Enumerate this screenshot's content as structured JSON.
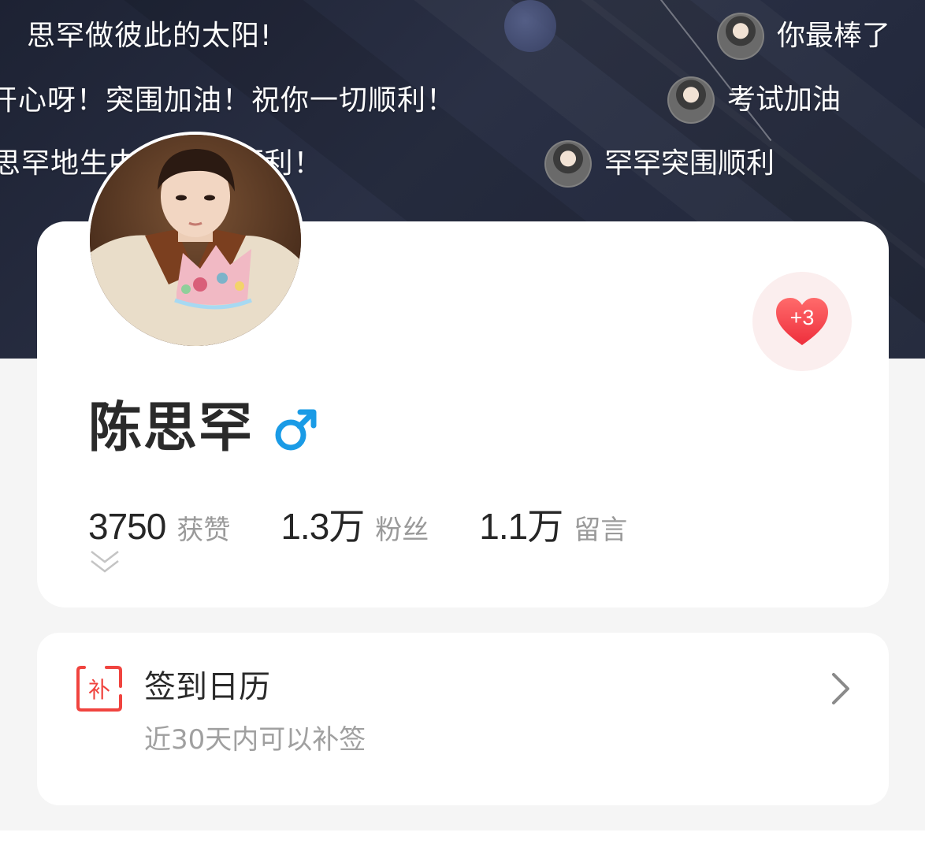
{
  "banner": {
    "danmaku_rows": [
      "思罕做彼此的太阳!",
      "开心呀！突围加油！祝你一切顺利！",
      "思罕地生中 ！一切顺利！"
    ],
    "danmaku_users": [
      {
        "text": "你最棒了",
        "avatar_icon": "user-avatar-icon"
      },
      {
        "text": "考试加油",
        "avatar_icon": "user-avatar-icon"
      },
      {
        "text": "罕罕突围顺利",
        "avatar_icon": "user-avatar-icon"
      }
    ]
  },
  "profile": {
    "name": "陈思罕",
    "gender": "male",
    "like_increment": "+3",
    "stats": [
      {
        "value": "3750",
        "label": "获赞"
      },
      {
        "value": "1.3万",
        "label": "粉丝"
      },
      {
        "value": "1.1万",
        "label": "留言"
      }
    ]
  },
  "checkin": {
    "icon_text": "补",
    "title": "签到日历",
    "subtitle": "近30天内可以补签"
  },
  "colors": {
    "banner_bg": "#1d2233",
    "accent_red": "#f0443f",
    "gender_blue": "#1a9be6",
    "text_primary": "#262626",
    "text_secondary": "#9a9a9a"
  }
}
